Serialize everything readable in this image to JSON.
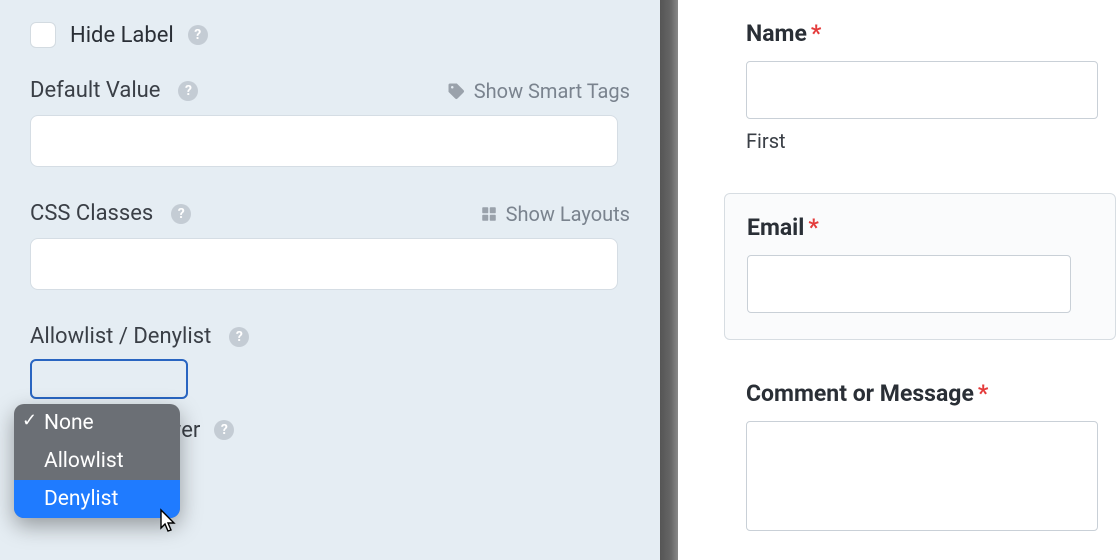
{
  "left": {
    "hide_label": "Hide Label",
    "default_value_label": "Default Value",
    "show_smart_tags": "Show Smart Tags",
    "css_classes_label": "CSS Classes",
    "show_layouts": "Show Layouts",
    "allowlist_label": "Allowlist / Denylist",
    "dropdown": {
      "options": [
        "None",
        "Allowlist",
        "Denylist"
      ],
      "selected": "None",
      "hovered": "Denylist"
    },
    "require_label": "nique answer"
  },
  "right": {
    "name_label": "Name",
    "name_sub": "First",
    "email_label": "Email",
    "comment_label": "Comment or Message"
  }
}
